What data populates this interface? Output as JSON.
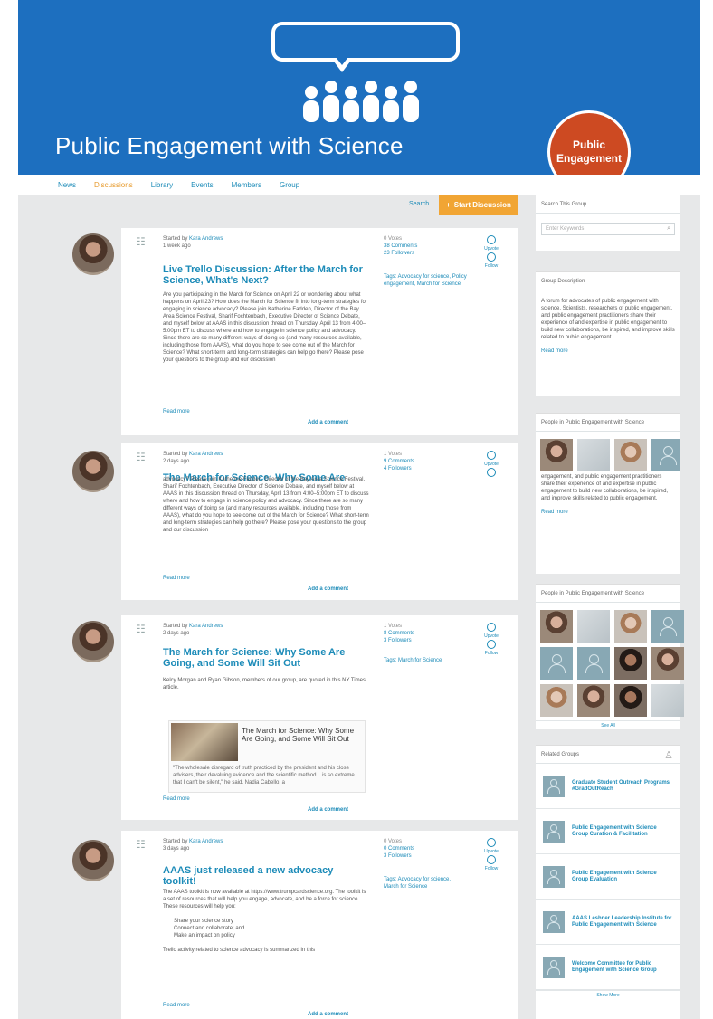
{
  "banner": {
    "title": "Public Engagement with Science",
    "badge_line1": "Public",
    "badge_line2": "Engagement"
  },
  "nav": [
    "News",
    "Discussions",
    "Library",
    "Events",
    "Members",
    "Group"
  ],
  "toolbar": {
    "search_label": "Search",
    "start_label": "Start Discussion"
  },
  "threads": [
    {
      "meta_prefix": "Started by",
      "author": "Kara Andrews",
      "time": "1 week ago",
      "title": "Live Trello Discussion: After the March for Science, What's Next?",
      "stats": [
        "0 Votes",
        "38 Comments",
        "23 Followers"
      ],
      "tags": "Tags: Advocacy for science, Policy engagement, March for Science",
      "body": "Are you participating in the March for Science on April 22 or wondering about what happens on April 23? How does the March for Science fit into long-term strategies for engaging in science advocacy? Please join Katherine Fadden, Director of the Bay Area Science Festival, Sharif Fochtenbach, Executive Director of Science Debate, and myself below at AAAS in this discussion thread on Thursday, April 13 from 4:00–5:00pm ET to discuss where and how to engage in science policy and advocacy. Since there are so many different ways of doing so (and many resources available, including those from AAAS), what do you hope to see come out of the March for Science? What short-term and long-term strategies can help go there? Please pose your questions to the group and our discussion",
      "readmore": "Read more",
      "add_comment": "Add a comment",
      "actions": [
        "Upvote",
        "Follow"
      ]
    },
    {
      "meta_prefix": "Started by",
      "author": "Kara Andrews",
      "time": "2 days ago",
      "title": "The March for Science: Why Some Are Going...",
      "stats": [
        "1 Votes",
        "9 Comments",
        "4 Followers"
      ],
      "tags": "",
      "body": "advocacy? Please join Katherine Fadden, Director of the Bay Area Science Festival, Sharif Fochtenbach, Executive Director of Science Debate, and myself below at AAAS in this discussion thread on Thursday, April 13 from 4:00–5:00pm ET to discuss where and how to engage in science policy and advocacy. Since there are so many different ways of doing so (and many resources available, including those from AAAS), what do you hope to see come out of the March for Science? What short-term and long-term strategies can help go there? Please pose your questions to the group and our discussion",
      "readmore": "Read more",
      "add_comment": "Add a comment",
      "actions": [
        "Upvote",
        "Follow"
      ]
    },
    {
      "meta_prefix": "Started by",
      "author": "Kara Andrews",
      "time": "2 days ago",
      "title": "The March for Science: Why Some Are Going, and Some Will Sit Out",
      "stats": [
        "1 Votes",
        "8 Comments",
        "3 Followers"
      ],
      "tags": "Tags: March for Science",
      "body": "Kelcy Morgan and Ryan Gibson, members of our group, are quoted in this NY Times article.",
      "preview_title": "The March for Science: Why Some Are Going, and Some Will Sit Out",
      "preview_text": "\"The wholesale disregard of truth practiced by the president and his close advisers, their devaluing evidence and the scientific method... is so extreme that I can't be silent,\" he said. Nadia Cabello, a",
      "readmore": "Read more",
      "add_comment": "Add a comment",
      "actions": [
        "Upvote",
        "Follow"
      ]
    },
    {
      "meta_prefix": "Started by",
      "author": "Kara Andrews",
      "time": "3 days ago",
      "title": "AAAS just released a new advocacy toolkit!",
      "stats": [
        "0 Votes",
        "0 Comments",
        "3 Followers"
      ],
      "tags": "Tags: Advocacy for science, March for Science",
      "body": "The AAAS toolkit is now available at https://www.trumpcardscience.org. The toolkit is a set of resources that will help you engage, advocate, and be a force for science. These resources will help you:",
      "bullets": [
        "Share your science story",
        "Connect and collaborate; and",
        "Make an impact on policy"
      ],
      "body2": "Trello activity related to science advocacy is summarized in this",
      "readmore": "Read more",
      "add_comment": "Add a comment",
      "actions": [
        "Upvote",
        "Follow"
      ]
    }
  ],
  "sidebar": {
    "search_title": "Search This Group",
    "search_placeholder": "Enter Keywords",
    "desc_title": "Group Description",
    "desc_text": "A forum for advocates of public engagement with science. Scientists, researchers of public engagement, and public engagement practitioners share their experience of and expertise in public engagement to build new collaborations, be inspired, and improve skills related to public engagement.",
    "read_more": "Read more",
    "people_title": "People in Public Engagement with Science",
    "people2_title": "People in Public Engagement with Science",
    "people_overlay": "engagement, and public engagement practitioners share their experience of and expertise in public engagement to build new collaborations, be inspired, and improve skills related to public engagement.",
    "see_all": "See All",
    "related_title": "Related Groups",
    "related": [
      "Graduate Student Outreach Programs #GradOutReach",
      "Public Engagement with Science Group Curation & Facilitation",
      "Public Engagement with Science Group Evaluation",
      "AAAS Leshner Leadership Institute for Public Engagement with Science",
      "Welcome Committee for Public Engagement with Science Group"
    ],
    "show_more": "Show More"
  },
  "colors": {
    "banner": "#1d6fbf",
    "badge": "#cd4a22",
    "accent": "#f1a534",
    "link": "#1c8bb8"
  }
}
